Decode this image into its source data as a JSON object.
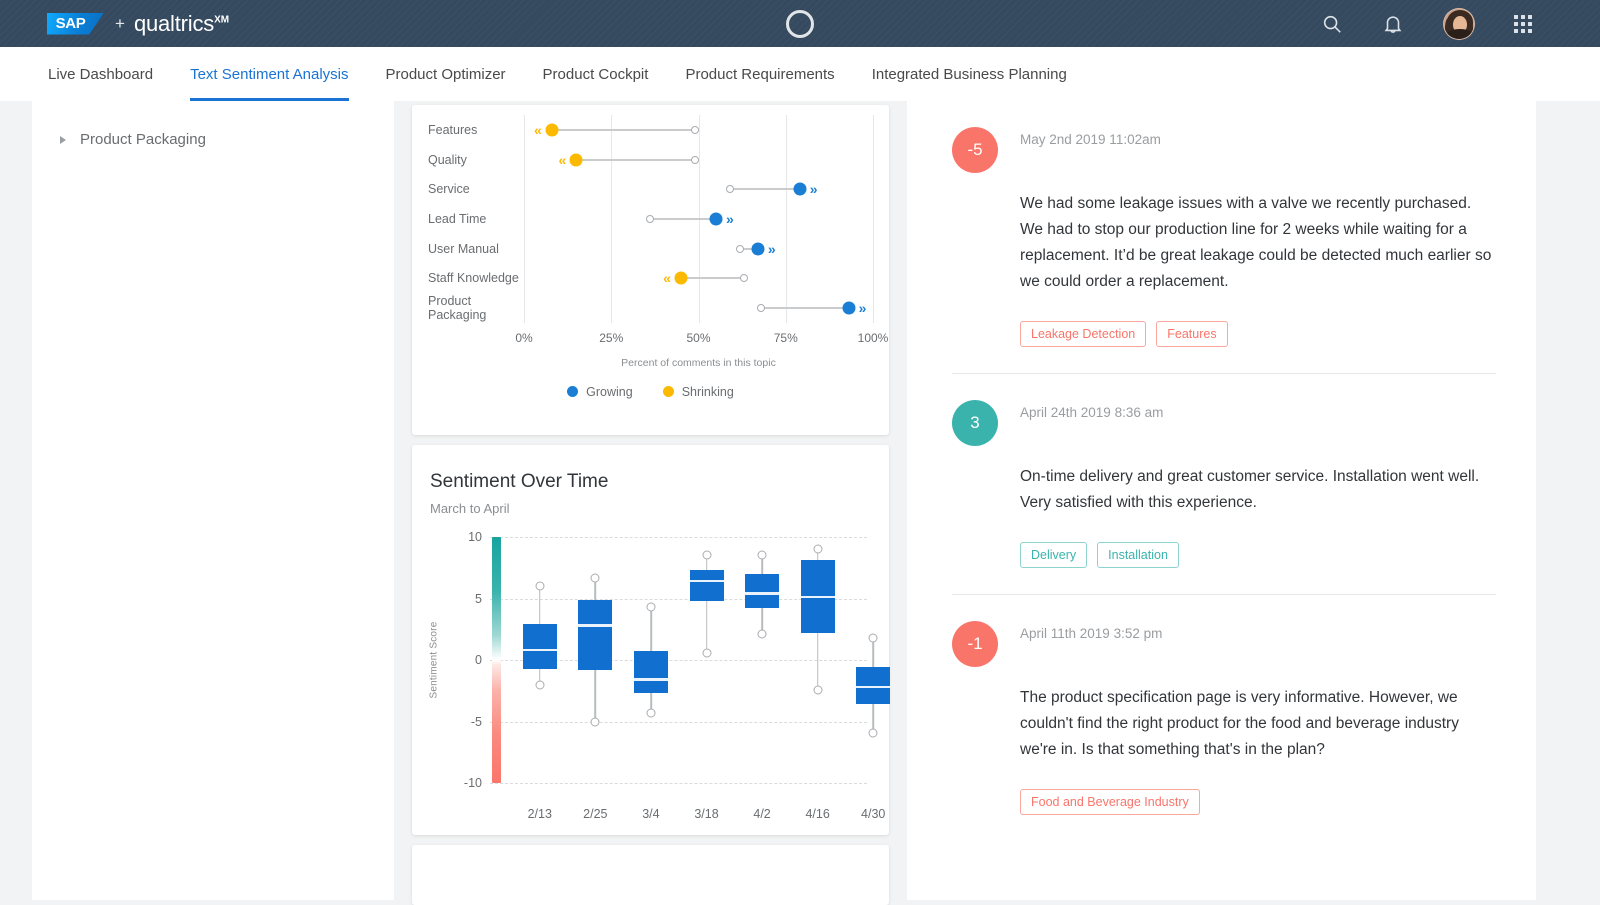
{
  "header": {
    "brand_sap": "SAP",
    "brand_plus": "+",
    "brand_qualtrics": "qualtrics",
    "brand_qualtrics_sup": "XM",
    "icons": {
      "search": "search-icon",
      "bell": "notification-bell-icon",
      "avatar": "user-avatar",
      "apps": "app-grid-icon",
      "orb": "loading-orb-icon"
    },
    "background_color": "#354a5f"
  },
  "tabs": [
    {
      "label": "Live Dashboard",
      "active": false
    },
    {
      "label": "Text Sentiment Analysis",
      "active": true
    },
    {
      "label": "Product Optimizer",
      "active": false
    },
    {
      "label": "Product Cockpit",
      "active": false
    },
    {
      "label": "Product Requirements",
      "active": false
    },
    {
      "label": "Integrated Business Planning",
      "active": false
    }
  ],
  "tab_accent_color": "#1a73d4",
  "sidebar": {
    "items": [
      {
        "label": "Product Packaging",
        "expanded": false
      }
    ]
  },
  "chart_data": [
    {
      "type": "bar",
      "chart_name": "topic-trend-dumbbell",
      "title": "",
      "xlabel": "Percent of comments in this topic",
      "ylabel": "",
      "xlim": [
        0,
        100
      ],
      "xticks": [
        "0%",
        "25%",
        "50%",
        "75%",
        "100%"
      ],
      "xtick_values": [
        0,
        25,
        50,
        75,
        100
      ],
      "grid": true,
      "legend": [
        {
          "label": "Growing",
          "color": "#1a7fd4"
        },
        {
          "label": "Shrinking",
          "color": "#fbb900"
        }
      ],
      "legend_position": "bottom",
      "categories": [
        "Features",
        "Quality",
        "Service",
        "Lead Time",
        "User Manual",
        "Staff Knowledge",
        "Product Packaging"
      ],
      "series": [
        {
          "name": "previous",
          "values": [
            49,
            49,
            59,
            36,
            62,
            63,
            68
          ]
        },
        {
          "name": "current",
          "values": [
            8,
            15,
            79,
            55,
            67,
            45,
            93
          ]
        }
      ],
      "direction": [
        "shrinking",
        "shrinking",
        "growing",
        "growing",
        "growing",
        "shrinking",
        "growing"
      ]
    },
    {
      "type": "box",
      "chart_name": "sentiment-over-time",
      "title": "Sentiment Over Time",
      "subtitle": "March to April",
      "xlabel": "",
      "ylabel": "Sentiment Score",
      "ylim": [
        -10,
        10
      ],
      "yticks": [
        10,
        5,
        0,
        -5,
        -10
      ],
      "grid": true,
      "categories": [
        "2/13",
        "2/25",
        "3/4",
        "3/18",
        "4/2",
        "4/16",
        "4/30"
      ],
      "boxes": [
        {
          "category": "2/13",
          "min": -2.0,
          "q1": -0.7,
          "median": 0.8,
          "q3": 2.9,
          "max": 6.0
        },
        {
          "category": "2/25",
          "min": -5.0,
          "q1": -0.8,
          "median": 2.8,
          "q3": 4.9,
          "max": 6.7
        },
        {
          "category": "3/4",
          "min": -4.3,
          "q1": -2.7,
          "median": -1.6,
          "q3": 0.7,
          "max": 4.3
        },
        {
          "category": "3/18",
          "min": 0.6,
          "q1": 4.8,
          "median": 6.4,
          "q3": 7.3,
          "max": 8.5
        },
        {
          "category": "4/2",
          "min": 2.1,
          "q1": 4.2,
          "median": 5.4,
          "q3": 7.0,
          "max": 8.5
        },
        {
          "category": "4/16",
          "min": -2.4,
          "q1": 2.2,
          "median": 5.1,
          "q3": 8.1,
          "max": 9.0
        },
        {
          "category": "4/30",
          "min": -5.9,
          "q1": -3.6,
          "median": -2.2,
          "q3": -0.6,
          "max": 1.8
        }
      ],
      "box_color": "#1170cf",
      "gradient_scale": {
        "top_color": "#18a3a0",
        "mid_color": "#ffffff",
        "bottom_color": "#fa766a"
      }
    }
  ],
  "comments": [
    {
      "score": "-5",
      "sentiment": "neg",
      "date": "May 2nd 2019 11:02am",
      "text": "We had some leakage issues with a valve we recently purchased. We had to stop our production line for 2 weeks while waiting for a replacement. It’d be great leakage could be detected much earlier so we could order a replacement.",
      "tags": [
        "Leakage Detection",
        "Features"
      ]
    },
    {
      "score": "3",
      "sentiment": "pos",
      "date": "April 24th 2019 8:36 am",
      "text": "On-time delivery and great customer service. Installation went well. Very satisfied with this experience.",
      "tags": [
        "Delivery",
        "Installation"
      ]
    },
    {
      "score": "-1",
      "sentiment": "neg",
      "date": "April 11th 2019 3:52 pm",
      "text": "The product specification page is very informative. However, we couldn't find the right product for the food and beverage industry we're in. Is that something that's in the plan?",
      "tags": [
        "Food and Beverage Industry"
      ]
    }
  ],
  "colors": {
    "positive": "#3bb3ad",
    "negative": "#f9756a",
    "growing": "#1a7fd4",
    "shrinking": "#fbb900",
    "accent": "#1a73d4"
  }
}
